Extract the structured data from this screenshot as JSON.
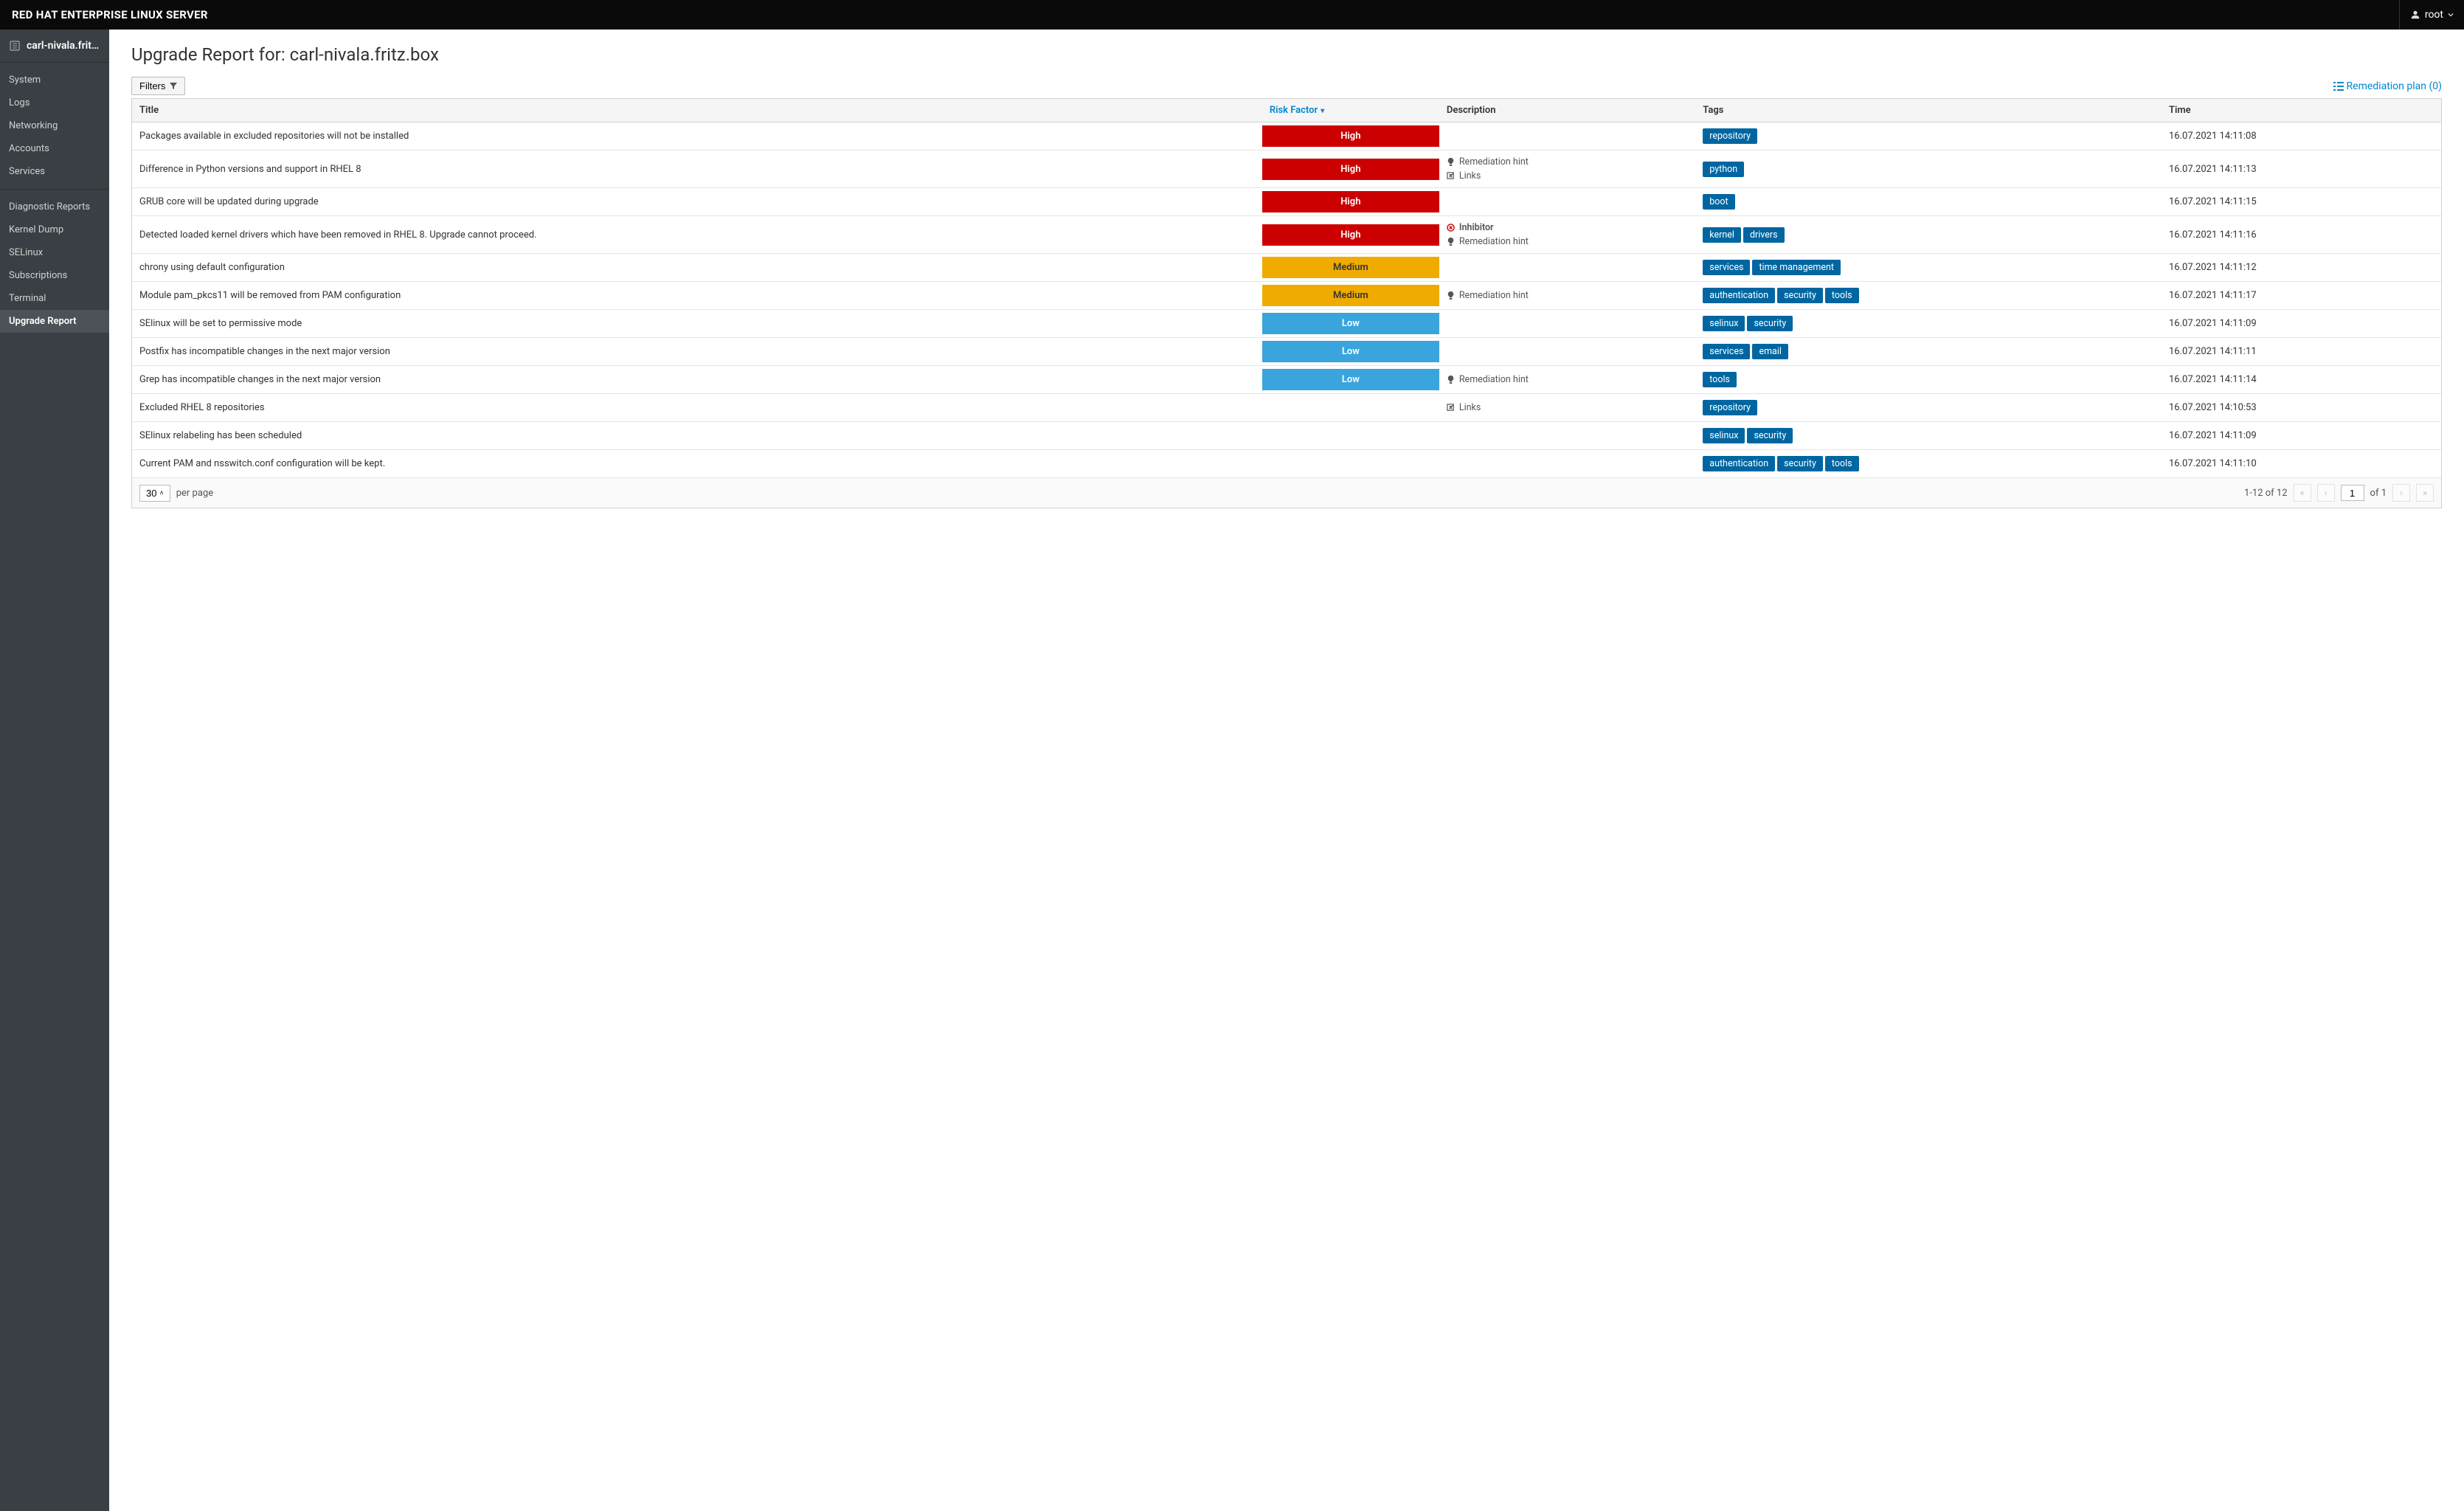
{
  "topbar": {
    "title": "RED HAT ENTERPRISE LINUX SERVER",
    "user": "root"
  },
  "sidebar": {
    "hostname": "carl-nivala.fritz....",
    "groups": [
      {
        "items": [
          {
            "label": "System"
          },
          {
            "label": "Logs"
          },
          {
            "label": "Networking"
          },
          {
            "label": "Accounts"
          },
          {
            "label": "Services"
          }
        ]
      },
      {
        "items": [
          {
            "label": "Diagnostic Reports"
          },
          {
            "label": "Kernel Dump"
          },
          {
            "label": "SELinux"
          },
          {
            "label": "Subscriptions"
          },
          {
            "label": "Terminal"
          },
          {
            "label": "Upgrade Report",
            "active": true
          }
        ]
      }
    ]
  },
  "page": {
    "title_prefix": "Upgrade Report for: ",
    "title_host": "carl-nivala.fritz.box",
    "filters_label": "Filters",
    "remediation_label": "Remediation plan (0)"
  },
  "columns": {
    "title": "Title",
    "risk": "Risk Factor",
    "desc": "Description",
    "tags": "Tags",
    "time": "Time"
  },
  "rows": [
    {
      "title": "Packages available in excluded repositories will not be installed",
      "risk": "High",
      "risk_class": "risk-high",
      "desc": [],
      "tags": [
        "repository"
      ],
      "time": "16.07.2021 14:11:08"
    },
    {
      "title": "Difference in Python versions and support in RHEL 8",
      "risk": "High",
      "risk_class": "risk-high",
      "desc": [
        {
          "type": "hint",
          "label": "Remediation hint"
        },
        {
          "type": "links",
          "label": "Links"
        }
      ],
      "tags": [
        "python"
      ],
      "time": "16.07.2021 14:11:13"
    },
    {
      "title": "GRUB core will be updated during upgrade",
      "risk": "High",
      "risk_class": "risk-high",
      "desc": [],
      "tags": [
        "boot"
      ],
      "time": "16.07.2021 14:11:15"
    },
    {
      "title": "Detected loaded kernel drivers which have been removed in RHEL 8. Upgrade cannot proceed.",
      "risk": "High",
      "risk_class": "risk-high",
      "desc": [
        {
          "type": "inhibitor",
          "label": "Inhibitor"
        },
        {
          "type": "hint",
          "label": "Remediation hint"
        }
      ],
      "tags": [
        "kernel",
        "drivers"
      ],
      "time": "16.07.2021 14:11:16"
    },
    {
      "title": "chrony using default configuration",
      "risk": "Medium",
      "risk_class": "risk-medium",
      "desc": [],
      "tags": [
        "services",
        "time management"
      ],
      "time": "16.07.2021 14:11:12"
    },
    {
      "title": "Module pam_pkcs11 will be removed from PAM configuration",
      "risk": "Medium",
      "risk_class": "risk-medium",
      "desc": [
        {
          "type": "hint",
          "label": "Remediation hint"
        }
      ],
      "tags": [
        "authentication",
        "security",
        "tools"
      ],
      "time": "16.07.2021 14:11:17"
    },
    {
      "title": "SElinux will be set to permissive mode",
      "risk": "Low",
      "risk_class": "risk-low",
      "desc": [],
      "tags": [
        "selinux",
        "security"
      ],
      "time": "16.07.2021 14:11:09"
    },
    {
      "title": "Postfix has incompatible changes in the next major version",
      "risk": "Low",
      "risk_class": "risk-low",
      "desc": [],
      "tags": [
        "services",
        "email"
      ],
      "time": "16.07.2021 14:11:11"
    },
    {
      "title": "Grep has incompatible changes in the next major version",
      "risk": "Low",
      "risk_class": "risk-low",
      "desc": [
        {
          "type": "hint",
          "label": "Remediation hint"
        }
      ],
      "tags": [
        "tools"
      ],
      "time": "16.07.2021 14:11:14"
    },
    {
      "title": "Excluded RHEL 8 repositories",
      "risk": "",
      "risk_class": "risk-none",
      "desc": [
        {
          "type": "links",
          "label": "Links"
        }
      ],
      "tags": [
        "repository"
      ],
      "time": "16.07.2021 14:10:53"
    },
    {
      "title": "SElinux relabeling has been scheduled",
      "risk": "",
      "risk_class": "risk-none",
      "desc": [],
      "tags": [
        "selinux",
        "security"
      ],
      "time": "16.07.2021 14:11:09"
    },
    {
      "title": "Current PAM and nsswitch.conf configuration will be kept.",
      "risk": "",
      "risk_class": "risk-none",
      "desc": [],
      "tags": [
        "authentication",
        "security",
        "tools"
      ],
      "time": "16.07.2021 14:11:10"
    }
  ],
  "footer": {
    "per_page_value": "30",
    "per_page_label": "per page",
    "range": "1-12 of 12",
    "page_current": "1",
    "page_of": "of 1"
  }
}
